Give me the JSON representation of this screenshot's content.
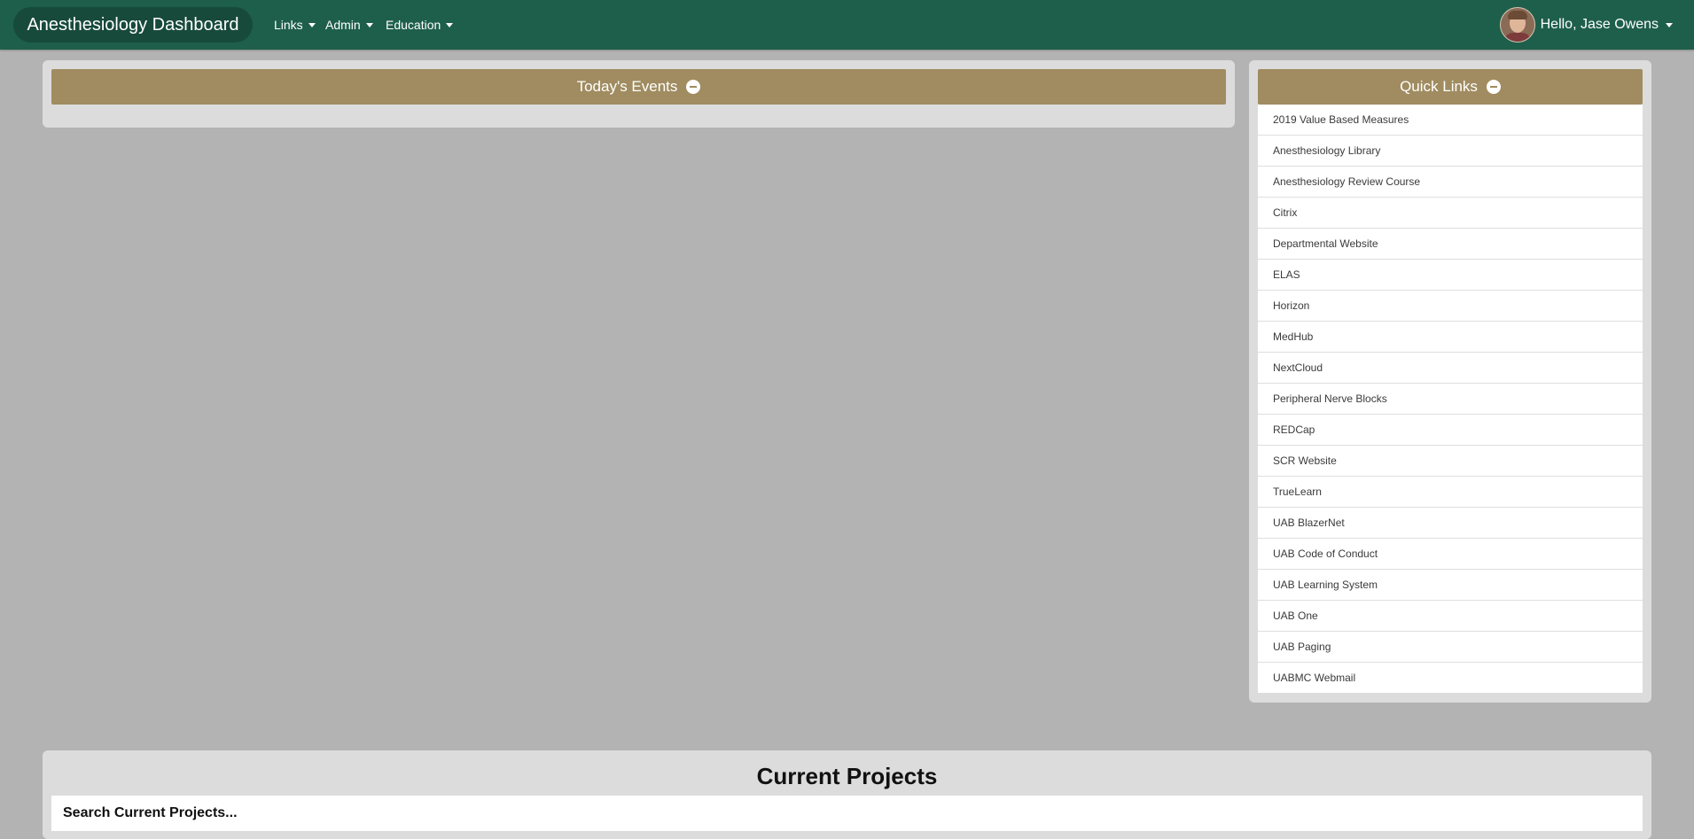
{
  "navbar": {
    "brand": "Anesthesiology Dashboard",
    "menus": [
      {
        "label": "Links"
      },
      {
        "label": "Admin"
      },
      {
        "label": "Education"
      }
    ],
    "user_greeting": "Hello, Jase Owens",
    "background_color": "#1e5f4b"
  },
  "events": {
    "title": "Today's Events"
  },
  "quick_links": {
    "title": "Quick Links",
    "items": [
      "2019 Value Based Measures",
      "Anesthesiology Library",
      "Anesthesiology Review Course",
      "Citrix",
      "Departmental Website",
      "ELAS",
      "Horizon",
      "MedHub",
      "NextCloud",
      "Peripheral Nerve Blocks",
      "REDCap",
      "SCR Website",
      "TrueLearn",
      "UAB BlazerNet",
      "UAB Code of Conduct",
      "UAB Learning System",
      "UAB One",
      "UAB Paging",
      "UABMC Webmail"
    ]
  },
  "projects": {
    "title": "Current Projects",
    "search_placeholder": "Search Current Projects..."
  },
  "colors": {
    "header_gold": "#a08c60",
    "page_background": "#b3b3b3",
    "panel_background": "#dcdcdc"
  }
}
